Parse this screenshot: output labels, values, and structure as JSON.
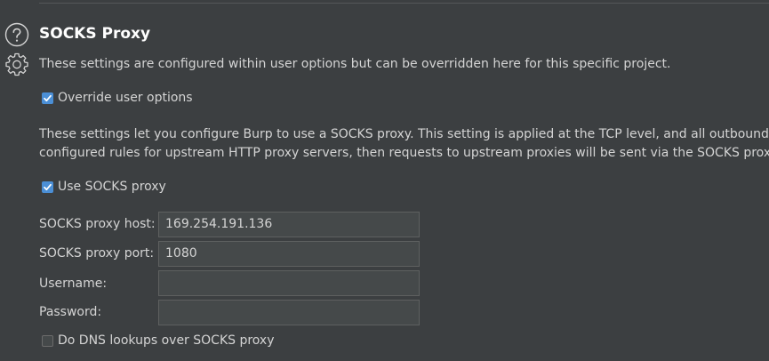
{
  "section": {
    "title": "SOCKS Proxy",
    "subtitle": "These settings are configured within user options but can be overridden here for this specific project."
  },
  "override": {
    "label": "Override user options",
    "checked": true
  },
  "description": {
    "line1": "These settings let you configure Burp to use a SOCKS proxy. This setting is applied at the TCP level, and all outbound re",
    "line2": "configured rules for upstream HTTP proxy servers, then requests to upstream proxies will be sent via the SOCKS proxy c"
  },
  "use_socks": {
    "label": "Use SOCKS proxy",
    "checked": true
  },
  "fields": {
    "host": {
      "label": "SOCKS proxy host:",
      "value": "169.254.191.136"
    },
    "port": {
      "label": "SOCKS proxy port:",
      "value": "1080"
    },
    "username": {
      "label": "Username:",
      "value": ""
    },
    "password": {
      "label": "Password:",
      "value": ""
    }
  },
  "dns": {
    "label": "Do DNS lookups over SOCKS proxy",
    "checked": false
  },
  "icons": {
    "help": "help-circle-icon",
    "settings": "gear-icon"
  },
  "colors": {
    "background": "#3c3f41",
    "accent": "#4b8fd6",
    "text": "#d4d4d4",
    "input_background": "#45494a"
  }
}
